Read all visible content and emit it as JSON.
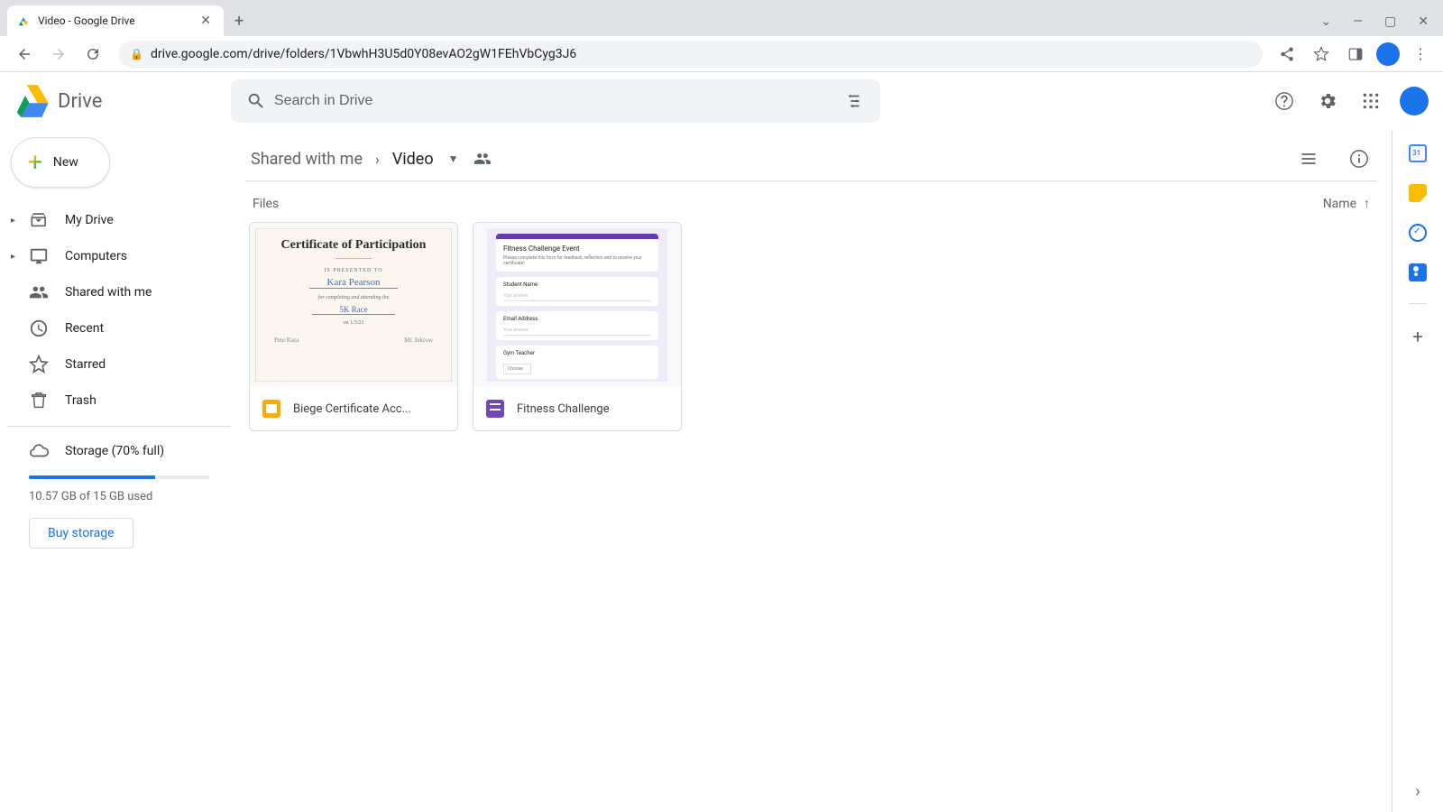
{
  "browser": {
    "tab_title": "Video - Google Drive",
    "url": "drive.google.com/drive/folders/1VbwhH3U5d0Y08evAO2gW1FEhVbCyg3J6"
  },
  "header": {
    "product": "Drive",
    "search_placeholder": "Search in Drive"
  },
  "sidebar": {
    "new_label": "New",
    "items": [
      {
        "label": "My Drive",
        "expandable": true
      },
      {
        "label": "Computers",
        "expandable": true
      },
      {
        "label": "Shared with me",
        "expandable": false
      },
      {
        "label": "Recent",
        "expandable": false
      },
      {
        "label": "Starred",
        "expandable": false
      },
      {
        "label": "Trash",
        "expandable": false
      }
    ],
    "storage": {
      "label": "Storage (70% full)",
      "percent": 70,
      "used_text": "10.57 GB of 15 GB used",
      "buy_label": "Buy storage"
    }
  },
  "breadcrumbs": {
    "root": "Shared with me",
    "current": "Video"
  },
  "content": {
    "section_title": "Files",
    "sort_label": "Name",
    "files": [
      {
        "name": "Biege Certificate Acc...",
        "type": "slides"
      },
      {
        "name": "Fitness Challenge",
        "type": "forms"
      }
    ]
  },
  "thumbs": {
    "cert": {
      "title": "Certificate of Participation",
      "presented": "IS PRESENTED TO",
      "name": "Kara Pearson",
      "completing": "for completing and attending the",
      "race": "5K Race",
      "date": "on 1/3/23",
      "sig1": "Pete Kara",
      "sig2": "Mr. Inkrow"
    },
    "form": {
      "title": "Fitness Challenge Event",
      "desc": "Please complete this form for feedback, reflection and to receive your certificate!",
      "q1": "Student Name",
      "a1": "Your answer",
      "q2": "Email Address",
      "a2": "Your answer",
      "q3": "Gym Teacher",
      "a3": "Choose"
    }
  }
}
